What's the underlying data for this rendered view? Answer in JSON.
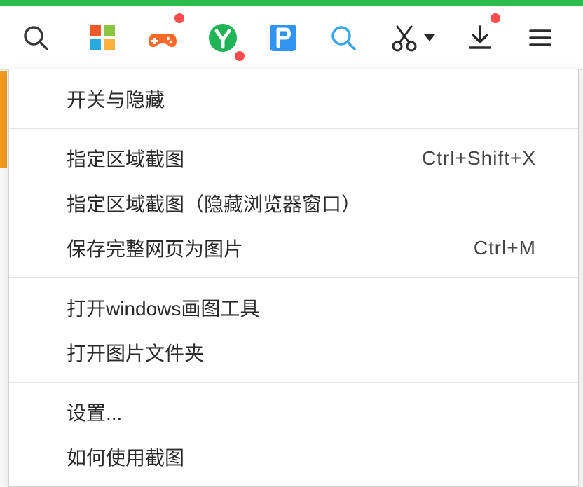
{
  "toolbar": {
    "icons": {
      "search": "search-icon",
      "apps": "apps-grid-icon",
      "games": "game-controller-icon",
      "y": "y-circle-icon",
      "p": "p-square-icon",
      "magnify": "magnify-icon",
      "scissors": "scissors-icon",
      "download": "download-icon",
      "menu": "menu-icon"
    }
  },
  "menu": {
    "group1": {
      "toggle_hide": "开关与隐藏"
    },
    "group2": {
      "capture_area": {
        "label": "指定区域截图",
        "shortcut": "Ctrl+Shift+X"
      },
      "capture_area_hidden": {
        "label": "指定区域截图（隐藏浏览器窗口）",
        "shortcut": ""
      },
      "save_full_page": {
        "label": "保存完整网页为图片",
        "shortcut": "Ctrl+M"
      }
    },
    "group3": {
      "open_paint": "打开windows画图工具",
      "open_folder": "打开图片文件夹"
    },
    "group4": {
      "settings": "设置...",
      "how_to": "如何使用截图"
    }
  },
  "colors": {
    "accent_green": "#2dbb4e",
    "orange": "#f39a1e",
    "blue": "#2f94f2",
    "red_badge": "#ff4b4b",
    "games_orange": "#ff6a2a"
  }
}
